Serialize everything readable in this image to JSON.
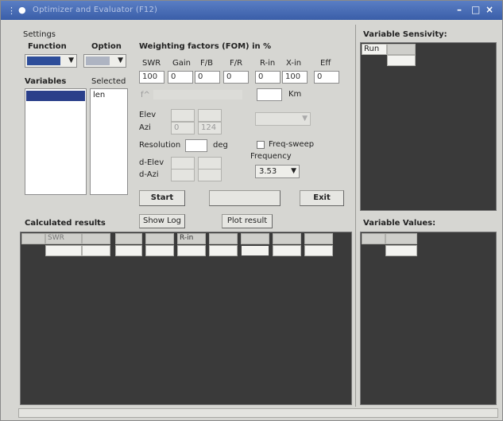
{
  "window": {
    "title": "Optimizer and Evaluator (F12)",
    "controls": {
      "minimize": "–",
      "maximize": "□",
      "close": "×"
    }
  },
  "settings": {
    "heading": "Settings",
    "function_label": "Function",
    "option_label": "Option",
    "function_value": "",
    "option_value": "",
    "variables_label": "Variables",
    "selected_label": "Selected",
    "variables_items": [
      ""
    ],
    "selected_items": [
      "len"
    ]
  },
  "weighting": {
    "heading": "Weighting factors (FOM) in %",
    "columns": [
      "SWR",
      "Gain",
      "F/B",
      "F/R",
      "R-in",
      "X-in",
      "Eff"
    ],
    "values": [
      "100",
      "0",
      "0",
      "0",
      "0",
      "100",
      "0"
    ],
    "f_label": "f^",
    "km_unit": "Km",
    "elev_label": "Elev",
    "azi_label": "Azi",
    "azi_values": [
      "0",
      "124"
    ],
    "resolution_label": "Resolution",
    "resolution_unit": "deg",
    "delta_elev_label": "d-Elev",
    "delta_azi_label": "d-Azi",
    "freq_sweep_label": "Freq-sweep",
    "frequency_label": "Frequency",
    "frequency_value": "3.53"
  },
  "actions": {
    "start": "Start",
    "exit": "Exit",
    "show_log": "Show Log",
    "plot_result": "Plot result"
  },
  "results": {
    "heading": "Calculated results",
    "header_cells": [
      "",
      "SWR",
      "",
      "",
      "",
      "R-in",
      "",
      "",
      "",
      ""
    ]
  },
  "sensitivity": {
    "heading": "Variable Sensivity:",
    "run_label": "Run"
  },
  "variable_values": {
    "heading": "Variable Values:"
  }
}
